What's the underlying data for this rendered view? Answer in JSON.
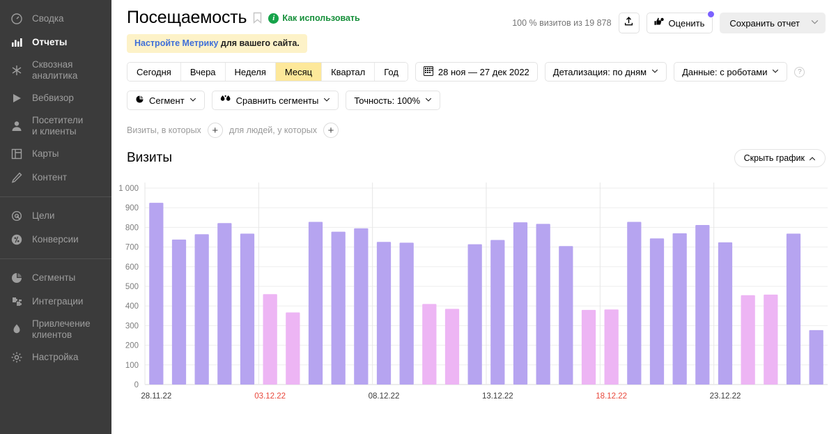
{
  "sidebar": {
    "groups": [
      {
        "items": [
          {
            "label": "Сводка",
            "icon": "gauge-icon",
            "active": false,
            "name": "summary"
          },
          {
            "label": "Отчеты",
            "icon": "bar-chart-icon",
            "active": true,
            "name": "reports"
          },
          {
            "label": "Сквозная\nаналитика",
            "icon": "snowflake-icon",
            "active": false,
            "name": "end-to-end-analytics"
          },
          {
            "label": "Вебвизор",
            "icon": "play-icon",
            "active": false,
            "name": "webvisor"
          },
          {
            "label": "Посетители\nи клиенты",
            "icon": "person-icon",
            "active": false,
            "name": "visitors-and-clients"
          },
          {
            "label": "Карты",
            "icon": "layout-icon",
            "active": false,
            "name": "maps"
          },
          {
            "label": "Контент",
            "icon": "pencil-icon",
            "active": false,
            "name": "content"
          }
        ]
      },
      {
        "items": [
          {
            "label": "Цели",
            "icon": "target-icon",
            "active": false,
            "name": "goals"
          },
          {
            "label": "Конверсии",
            "icon": "percent-icon",
            "active": false,
            "name": "conversions"
          }
        ]
      },
      {
        "items": [
          {
            "label": "Сегменты",
            "icon": "pie-icon",
            "active": false,
            "name": "segments"
          },
          {
            "label": "Интеграции",
            "icon": "puzzle-icon",
            "active": false,
            "name": "integrations"
          },
          {
            "label": "Привлечение\nклиентов",
            "icon": "flame-icon",
            "active": false,
            "name": "customer-acquisition"
          },
          {
            "label": "Настройка",
            "icon": "gear-icon",
            "active": false,
            "name": "settings"
          }
        ]
      }
    ]
  },
  "header": {
    "title": "Посещаемость",
    "howto_label": "Как использовать",
    "info_glyph": "i",
    "notice_link": "Настройте Метрику",
    "notice_text": " для вашего сайта.",
    "visits_info": "100 % визитов из 19 878",
    "export_icon": "upload-icon",
    "rate_label": "Оценить",
    "save_label": "Сохранить отчет"
  },
  "toolbar": {
    "periods": [
      {
        "label": "Сегодня",
        "selected": false
      },
      {
        "label": "Вчера",
        "selected": false
      },
      {
        "label": "Неделя",
        "selected": false
      },
      {
        "label": "Месяц",
        "selected": true
      },
      {
        "label": "Квартал",
        "selected": false
      },
      {
        "label": "Год",
        "selected": false
      }
    ],
    "date_range": "28 ноя — 27 дек 2022",
    "detail_label": "Детализация: по дням",
    "data_label": "Данные: с роботами",
    "help_glyph": "?",
    "segment_label": "Сегмент",
    "compare_label": "Сравнить сегменты",
    "accuracy_label": "Точность: 100%"
  },
  "filters": {
    "prefix": "Визиты, в которых",
    "middle": "для людей, у которых",
    "plus_glyph": "+"
  },
  "chart_panel": {
    "title": "Визиты",
    "hide_label": "Скрыть график",
    "chevron": "⌃"
  },
  "colors": {
    "bar_weekday": "#b6a4f0",
    "bar_weekend": "#edb5f4",
    "highlight_tick": "#e8483c",
    "accent_yellow": "#fde89a",
    "sidebar_bg": "#3b3b3b",
    "link_blue": "#3f6fd8",
    "green": "#168f3a"
  },
  "chart_data": {
    "type": "bar",
    "title": "Визиты",
    "xlabel": "",
    "ylabel": "",
    "ylim": [
      0,
      1000
    ],
    "ytick_values": [
      0,
      100,
      200,
      300,
      400,
      500,
      600,
      700,
      800,
      900,
      1000
    ],
    "ytick_labels": [
      "0",
      "100",
      "200",
      "300",
      "400",
      "500",
      "600",
      "700",
      "800",
      "900",
      "1 000"
    ],
    "grid": true,
    "legend": "none",
    "xtick_labels": [
      {
        "index": 0,
        "label": "28.11.22",
        "weekend": false
      },
      {
        "index": 5,
        "label": "03.12.22",
        "weekend": true
      },
      {
        "index": 10,
        "label": "08.12.22",
        "weekend": false
      },
      {
        "index": 15,
        "label": "13.12.22",
        "weekend": false
      },
      {
        "index": 20,
        "label": "18.12.22",
        "weekend": true
      },
      {
        "index": 25,
        "label": "23.12.22",
        "weekend": false
      }
    ],
    "categories": [
      "28.11.22",
      "29.11.22",
      "30.11.22",
      "01.12.22",
      "02.12.22",
      "03.12.22",
      "04.12.22",
      "05.12.22",
      "06.12.22",
      "07.12.22",
      "08.12.22",
      "09.12.22",
      "10.12.22",
      "11.12.22",
      "12.12.22",
      "13.12.22",
      "14.12.22",
      "15.12.22",
      "16.12.22",
      "17.12.22",
      "18.12.22",
      "19.12.22",
      "20.12.22",
      "21.12.22",
      "22.12.22",
      "23.12.22",
      "24.12.22",
      "25.12.22",
      "26.12.22",
      "27.12.22"
    ],
    "values": [
      925,
      738,
      765,
      822,
      768,
      460,
      367,
      828,
      778,
      795,
      726,
      722,
      410,
      385,
      714,
      736,
      826,
      818,
      705,
      380,
      382,
      828,
      744,
      770,
      812,
      724,
      455,
      458,
      768,
      277
    ],
    "weekend_flags": [
      false,
      false,
      false,
      false,
      false,
      true,
      true,
      false,
      false,
      false,
      false,
      false,
      true,
      true,
      false,
      false,
      false,
      false,
      false,
      true,
      true,
      false,
      false,
      false,
      false,
      false,
      true,
      true,
      false,
      false
    ]
  }
}
